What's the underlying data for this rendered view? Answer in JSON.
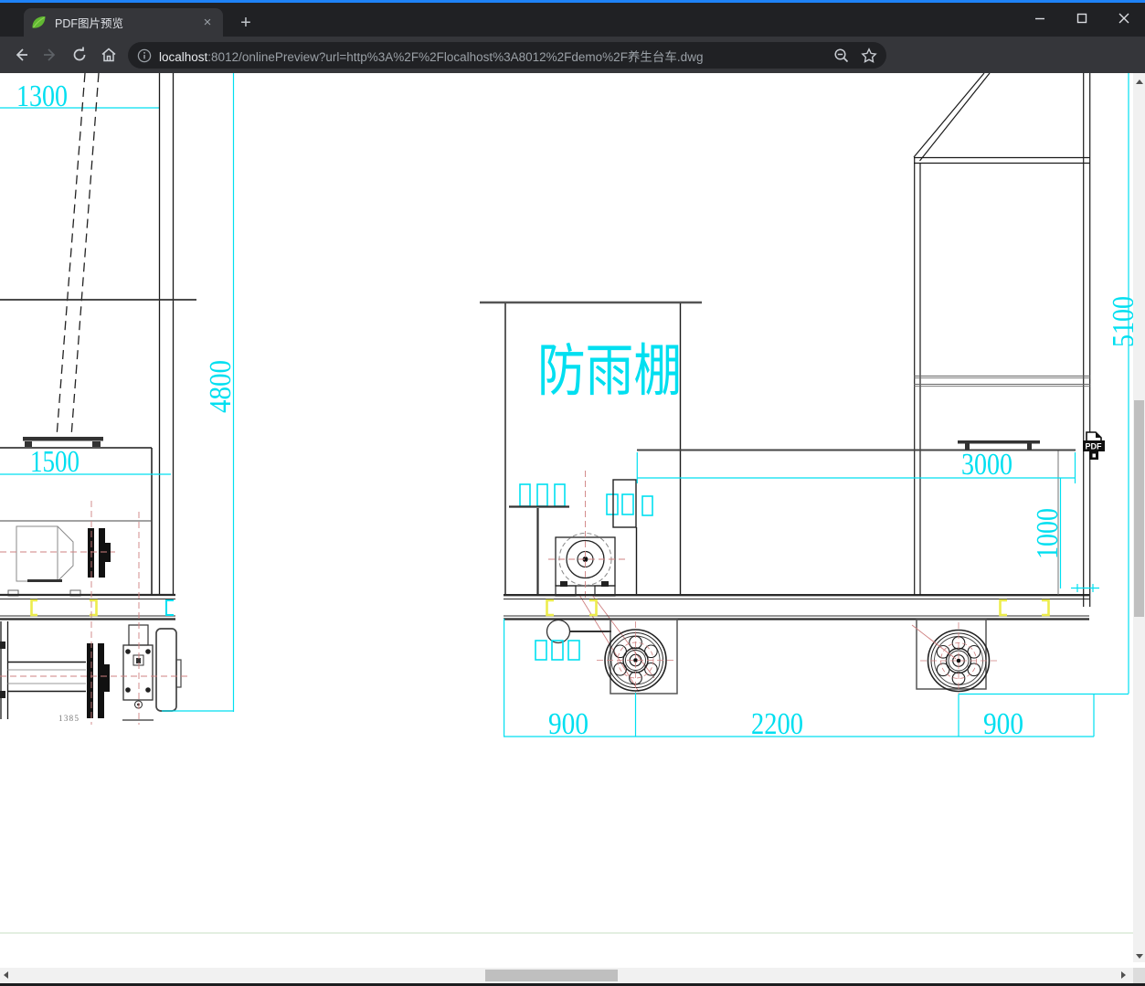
{
  "titlebar": {
    "tab_title": "PDF图片预览",
    "new_tab": "+",
    "close_tab": "×"
  },
  "toolbar": {
    "url_host": "localhost",
    "url_rest": ":8012/onlinePreview?url=http%3A%2F%2Flocalhost%3A8012%2Fdemo%2F养生台车.dwg"
  },
  "drawing": {
    "canopy_label": "防雨棚",
    "pdf_badge": "PDF",
    "dims": {
      "top_left": "1300",
      "left_height": "4800",
      "tank_width": "1500",
      "axle_span": "1385",
      "front_overhang": "900",
      "wheelbase": "2200",
      "rear_overhang": "900",
      "deck_length": "3000",
      "deck_height": "1000",
      "total_height": "5100"
    },
    "colors": {
      "dimension": "#00dff0",
      "highlight": "#ecec4e",
      "centerline": "#cf8080",
      "line": "#1a1a1a"
    }
  }
}
